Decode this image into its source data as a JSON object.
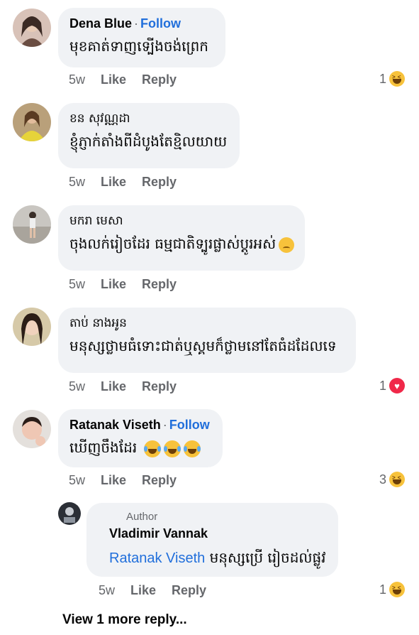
{
  "comments": [
    {
      "name": "Dena Blue",
      "follow": "Follow",
      "text": "មុខគាត់ទាញទ្បើងចង់ព្រេក",
      "time": "5w",
      "like": "Like",
      "reply": "Reply",
      "reaction_count": "1",
      "reaction": "haha-icon"
    },
    {
      "name": "ខន សុវណ្ណដា",
      "text": "ខ្ញុំភ្ញាក់តាំងពីដំបូងតែខ្មិលយាយ",
      "time": "5w",
      "like": "Like",
      "reply": "Reply"
    },
    {
      "name": "មករា មេសា",
      "text": "ចុងលក់រៀចដែរ ធម្មជាតិទ្បូរផ្លាស់ប្ដូរអស់",
      "time": "5w",
      "like": "Like",
      "reply": "Reply"
    },
    {
      "name": "តាប់ នាងអូន",
      "text": "មនុស្សថ្លាមធំទោះជាត់ឬស្គមក៏ថ្លាមនៅតែធំដដែលទេ",
      "time": "5w",
      "like": "Like",
      "reply": "Reply",
      "reaction_count": "1",
      "reaction": "love-icon"
    },
    {
      "name": "Ratanak Viseth",
      "follow": "Follow",
      "text": "ឃើញចឹងដែរ",
      "time": "5w",
      "like": "Like",
      "reply": "Reply",
      "reaction_count": "3",
      "reaction": "haha-icon"
    }
  ],
  "reply": {
    "author_tag": "Author",
    "name": "Vladimir Vannak",
    "mention": "Ratanak Viseth",
    "text": "មនុស្សប្រើ រៀចដល់ផ្លូវ",
    "time": "5w",
    "like": "Like",
    "reply": "Reply",
    "reaction_count": "1",
    "reaction": "haha-icon"
  },
  "view_more": "View 1 more reply..."
}
